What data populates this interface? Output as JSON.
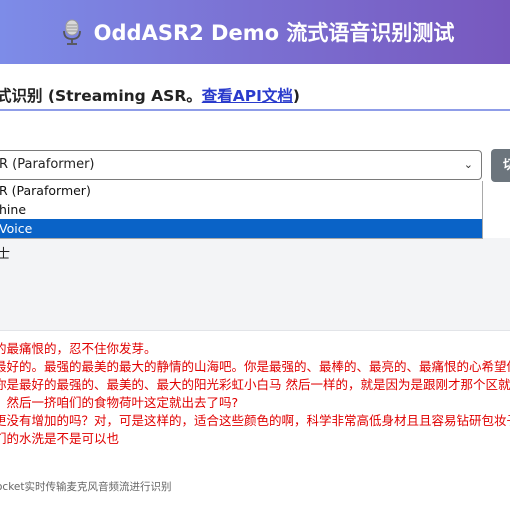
{
  "header": {
    "title": "OddASR2 Demo 流式语音识别测试",
    "icon": "microphone-icon"
  },
  "section": {
    "heading_prefix": "式识别 (Streaming ASR。",
    "api_link": "查看API文档",
    "heading_suffix": ")"
  },
  "model_select": {
    "value": "R (Paraformer)",
    "options": [
      "R (Paraformer)",
      "hine",
      "Voice"
    ],
    "selected_index": 2
  },
  "side_button": {
    "label": "切"
  },
  "panel": {
    "partial_label": "士"
  },
  "results": [
    "的最痛恨的，忍不住你发芽。",
    "最好的。最强的最美的最大的静情的山海吧。你是最强的、最棒的、最亮的、最痛恨的心希望你",
    "你是最好的最强的、最美的、最大的阳光彩虹小白马 然后一样的，就是因为是跟刚才那个区就",
    "。然后一挤咱们的食物荷叶这定就出去了吗?",
    "更没有增加的吗？对，可是这样的，适合这些颜色的啊，科学非常高低身材且且容易钻研包妆子",
    "们的水洗是不是可以也"
  ],
  "footer": {
    "note": "ocket实时传输麦克风音频流进行识别"
  },
  "colors": {
    "header_gradient_start": "#7d8ce8",
    "header_gradient_end": "#7758be",
    "link": "#2a3bcc",
    "result_text": "#e00000",
    "selected_option": "#0a63c7",
    "side_button": "#6c757d"
  }
}
